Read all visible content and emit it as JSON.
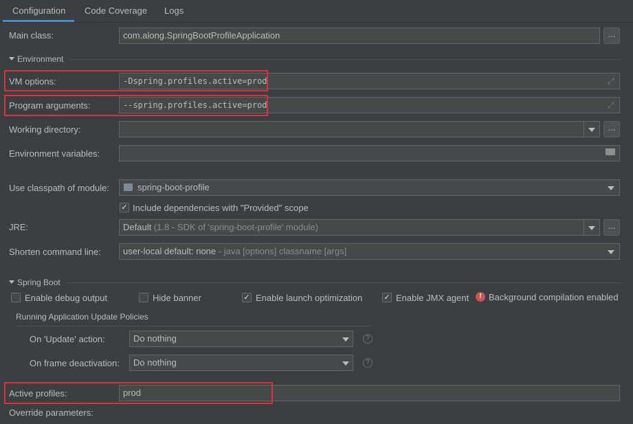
{
  "tabs": [
    "Configuration",
    "Code Coverage",
    "Logs"
  ],
  "main_class": {
    "label": "Main class:",
    "value": "com.along.SpringBootProfileApplication",
    "browse": "..."
  },
  "environment": {
    "title": "Environment",
    "vm_options": {
      "label": "VM options:",
      "value": "-Dspring.profiles.active=prod"
    },
    "program_arguments": {
      "label": "Program arguments:",
      "value": "--spring.profiles.active=prod"
    },
    "working_directory": {
      "label": "Working directory:",
      "value": "",
      "browse": "..."
    },
    "environment_variables": {
      "label": "Environment variables:",
      "value": ""
    }
  },
  "classpath": {
    "label": "Use classpath of module:",
    "value": "spring-boot-profile",
    "include_dependencies": {
      "label": "Include dependencies with \"Provided\" scope",
      "checked": true
    }
  },
  "jre": {
    "label": "JRE:",
    "value": "Default",
    "detail": "(1.8 - SDK of 'spring-boot-profile' module)",
    "browse": "..."
  },
  "shorten_command_line": {
    "label": "Shorten command line:",
    "value": "user-local default: none",
    "detail": " - java [options] classname [args]"
  },
  "spring_boot": {
    "title": "Spring Boot",
    "enable_debug_output": {
      "label": "Enable debug output",
      "checked": false
    },
    "hide_banner": {
      "label": "Hide banner",
      "checked": false
    },
    "enable_launch_optimization": {
      "label": "Enable launch optimization",
      "checked": true
    },
    "enable_jmx_agent": {
      "label": "Enable JMX agent",
      "checked": true
    },
    "background_compilation": "Background compilation enabled",
    "policies": {
      "title": "Running Application Update Policies",
      "on_update": {
        "label": "On 'Update' action:",
        "value": "Do nothing"
      },
      "on_frame_deactivation": {
        "label": "On frame deactivation:",
        "value": "Do nothing"
      }
    },
    "active_profiles": {
      "label": "Active profiles:",
      "value": "prod"
    },
    "override_parameters": {
      "label": "Override parameters:"
    }
  },
  "icons": {
    "check": "✓",
    "help": "?",
    "error": "!"
  },
  "colors": {
    "highlight": "#e0313a",
    "accent": "#4a88c7",
    "error": "#c75450"
  }
}
